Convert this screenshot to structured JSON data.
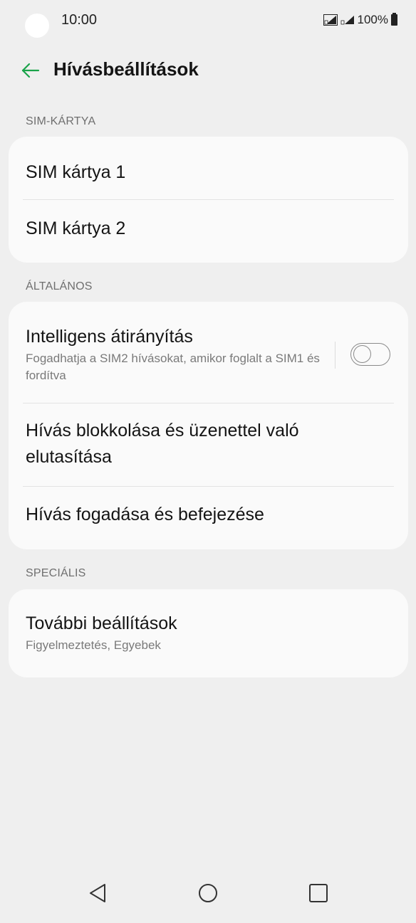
{
  "status": {
    "time": "10:00",
    "battery": "100%"
  },
  "header": {
    "title": "Hívásbeállítások"
  },
  "sections": {
    "sim": {
      "label": "SIM-KÁRTYA",
      "items": [
        "SIM kártya 1",
        "SIM kártya 2"
      ]
    },
    "general": {
      "label": "ÁLTALÁNOS",
      "smart_forwarding": {
        "title": "Intelligens átirányítás",
        "subtitle": "Fogadhatja a SIM2 hívásokat, amikor foglalt a SIM1 és fordítva",
        "enabled": false
      },
      "call_blocking": "Hívás blokkolása és üzenettel való elutasítása",
      "answer_end": "Hívás fogadása és befejezése"
    },
    "special": {
      "label": "SPECIÁLIS",
      "more": {
        "title": "További beállítások",
        "subtitle": "Figyelmeztetés, Egyebek"
      }
    }
  },
  "colors": {
    "accent": "#1aa34a",
    "background": "#efefef",
    "card": "#fafafa"
  },
  "icons": {
    "back": "arrow-left-icon",
    "nav_back": "triangle-back-icon",
    "nav_home": "circle-home-icon",
    "nav_recent": "square-recents-icon"
  }
}
